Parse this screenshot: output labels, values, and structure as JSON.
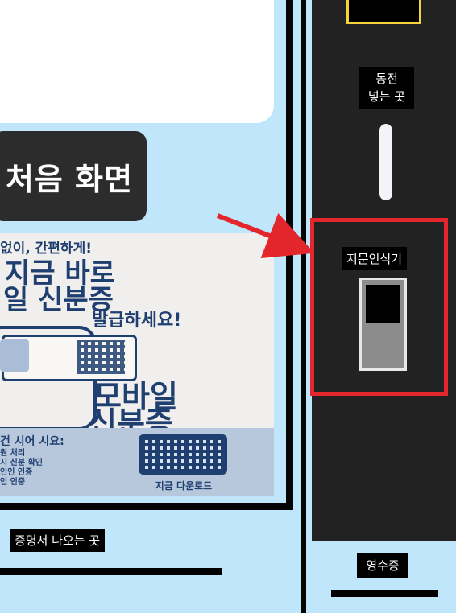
{
  "screen": {
    "home_button": "처음 화면"
  },
  "ad": {
    "line1": "없이, 간편하게!",
    "line2": "지금 바로",
    "line3": "일 신분증",
    "line4": "발급하세요!",
    "big1": "모바일",
    "big2": "신분증",
    "band_title": "건 시어 시요:",
    "band_list": "원 처리\n시 신분 확인\n인인 인증\n인 인증",
    "download_label": "지금 다운로드"
  },
  "slots": {
    "certificate_label": "증명서 나오는 곳",
    "coin_label": "동전\n넣는 곳",
    "fingerprint_label": "지문인식기",
    "receipt_label": "영수증"
  },
  "colors": {
    "background": "#bfe6fb",
    "machine": "#222222",
    "highlight": "#e3262b",
    "accent_yellow": "#f7d23b",
    "ad_text": "#1e3f70"
  }
}
